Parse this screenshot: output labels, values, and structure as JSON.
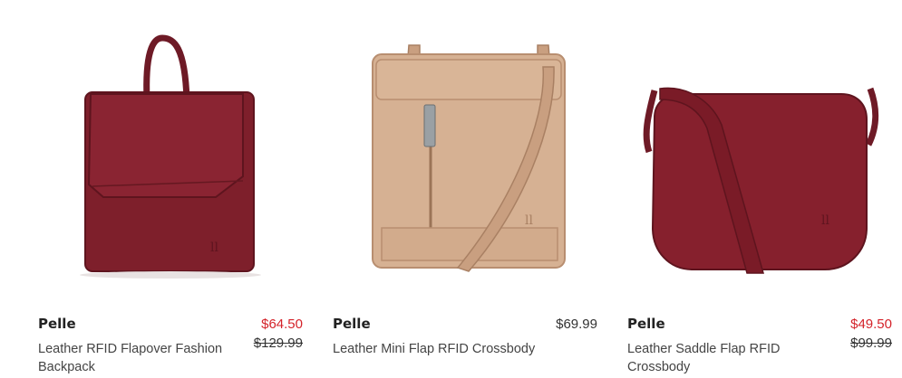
{
  "products": [
    {
      "brand": "Pelle",
      "title": "Leather RFID Flapover Fashion Backpack",
      "sale_price": "$64.50",
      "original_price": "$129.99",
      "image_icon": "burgundy-backpack",
      "color": "#7e1f2b"
    },
    {
      "brand": "Pelle",
      "title": "Leather Mini Flap RFID Crossbody",
      "price": "$69.99",
      "image_icon": "tan-crossbody",
      "color": "#d6b193"
    },
    {
      "brand": "Pelle",
      "title": "Leather Saddle Flap RFID Crossbody",
      "sale_price": "$49.50",
      "original_price": "$99.99",
      "image_icon": "burgundy-saddle-bag",
      "color": "#86202d"
    }
  ],
  "colors": {
    "sale": "#d4232a",
    "text": "#333333"
  }
}
